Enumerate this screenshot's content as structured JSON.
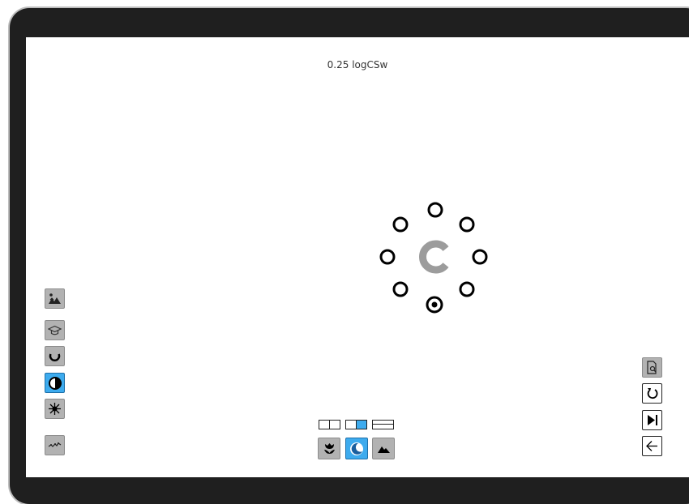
{
  "app": {
    "measurement": "0.25 logCSw"
  },
  "stimulus": {
    "optotype": "C",
    "optotype_color": "#999999",
    "response_positions": [
      "top",
      "top-right",
      "right",
      "bottom-right",
      "bottom",
      "bottom-left",
      "left",
      "top-left"
    ],
    "selected_position": "bottom"
  },
  "left_toolbar": {
    "items": [
      {
        "icon": "landscape-person-icon",
        "state": "normal"
      },
      {
        "icon": "graduation-cap-icon",
        "state": "normal"
      },
      {
        "icon": "landolt-c-icon",
        "state": "normal"
      },
      {
        "icon": "contrast-icon",
        "state": "active"
      },
      {
        "icon": "starburst-icon",
        "state": "normal"
      },
      {
        "icon": "graph-wave-icon",
        "state": "normal"
      }
    ]
  },
  "bottom_toolbar": {
    "layouts": [
      {
        "icon": "layout-split-vertical-icon",
        "state": "normal"
      },
      {
        "icon": "layout-right-highlight-icon",
        "state": "active"
      },
      {
        "icon": "layout-split-horizontal-icon",
        "state": "normal"
      }
    ],
    "buttons": [
      {
        "icon": "flower-icon",
        "state": "normal"
      },
      {
        "icon": "night-mode-icon",
        "state": "active"
      },
      {
        "icon": "mountain-icon",
        "state": "normal"
      }
    ]
  },
  "right_toolbar": {
    "items": [
      {
        "icon": "document-search-icon",
        "state": "normal"
      },
      {
        "icon": "refresh-icon",
        "state": "outline"
      },
      {
        "icon": "skip-next-icon",
        "state": "outline"
      },
      {
        "icon": "back-arrow-icon",
        "state": "outline"
      }
    ]
  },
  "colors": {
    "active": "#3dabee",
    "button_gray": "#b2b2b2",
    "bezel": "#1f1f1f"
  }
}
